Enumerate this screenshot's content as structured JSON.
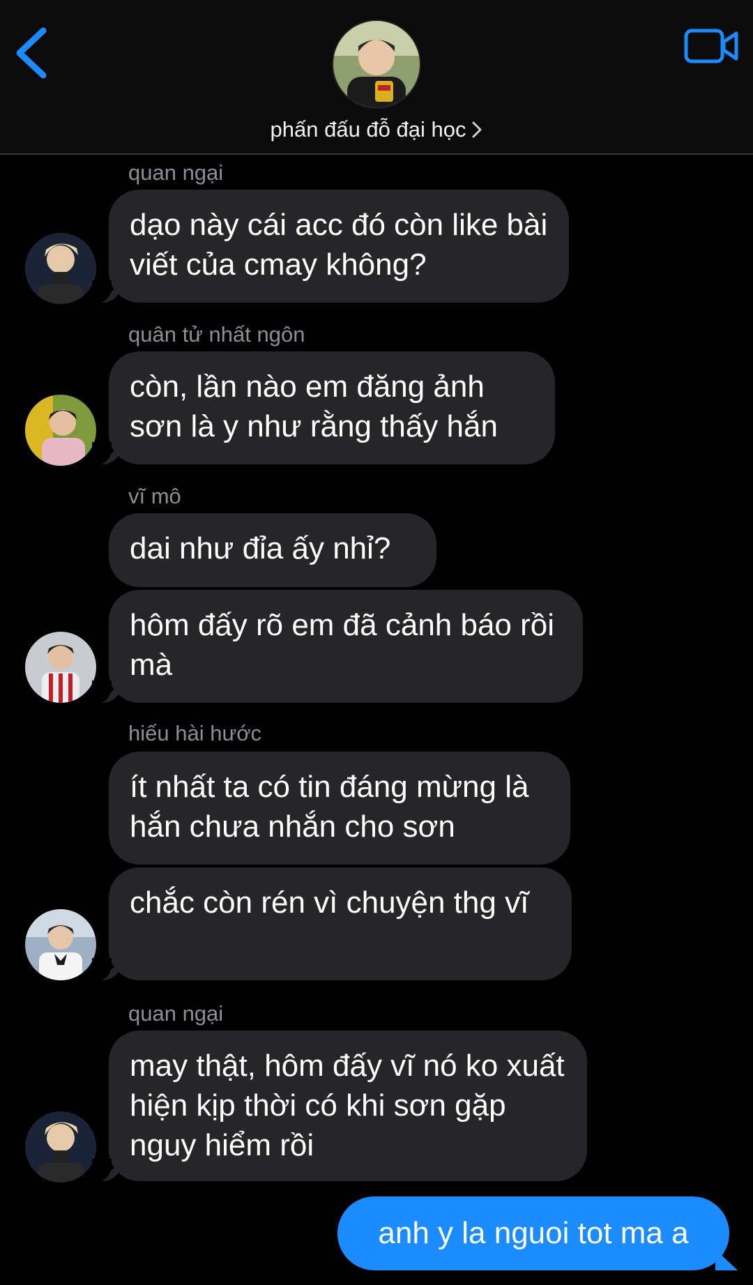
{
  "header": {
    "group_name": "phấn đấu đỗ đại học"
  },
  "messages": [
    {
      "sender": "quan ngại",
      "text": "dạo này cái acc đó còn like bài viết của cmay không?"
    },
    {
      "sender": "quân tử nhất ngôn",
      "text": "còn, lần nào em đăng ảnh sơn là y như rằng thấy hắn"
    },
    {
      "sender": "vĩ mô",
      "text": "dai như đỉa ấy nhỉ?"
    },
    {
      "sender": "",
      "text": "hôm đấy rõ em đã cảnh báo rồi mà"
    },
    {
      "sender": "hiếu hài hước",
      "text": "ít nhất ta có tin đáng mừng là hắn chưa nhắn cho sơn"
    },
    {
      "sender": "",
      "text": "chắc còn rén vì chuyện thg vĩ"
    },
    {
      "sender": "quan ngại",
      "text": "may thật, hôm đấy vĩ nó ko xuất hiện kịp thời có khi sơn gặp nguy hiểm rồi"
    }
  ],
  "my_message": {
    "text": "anh y la nguoi tot ma a"
  },
  "colors": {
    "background": "#000000",
    "incoming_bubble": "#262628",
    "outgoing_bubble": "#1a8cff",
    "accent": "#1a8cff",
    "sender_name": "#8e8e93"
  },
  "icons": {
    "back": "chevron-left-icon",
    "video": "video-camera-icon"
  }
}
